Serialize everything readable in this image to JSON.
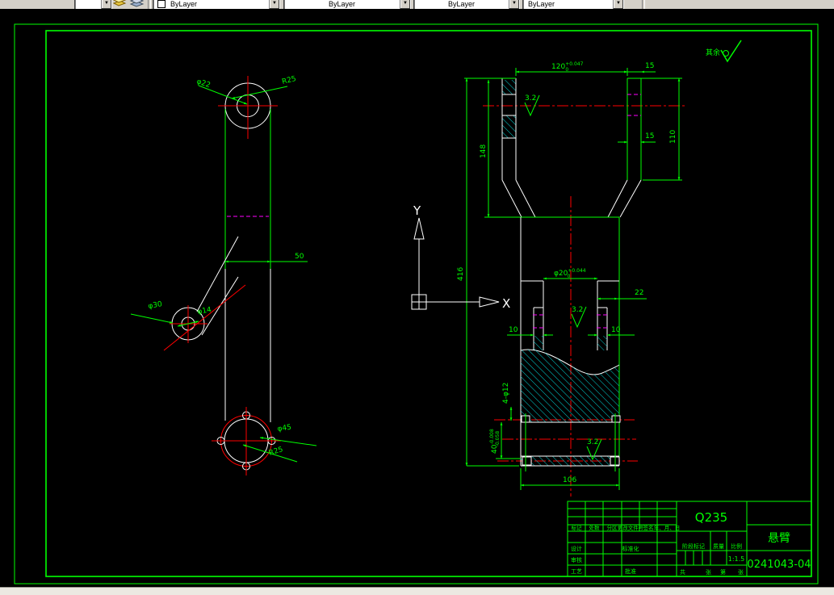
{
  "toolbar": {
    "combos": [
      "ByLayer",
      "ByLayer",
      "ByLayer",
      "ByLayer"
    ],
    "dropdown_glyph": "▼"
  },
  "colors": {
    "outline_green": "#00ff00",
    "centerline_red": "#ff0000",
    "hidden_magenta": "#ff00ff",
    "hatch_cyan": "#00cccc",
    "geometry_white": "#ffffff",
    "canvas_black": "#000000"
  },
  "ucs": {
    "x_label": "X",
    "y_label": "Y"
  },
  "notes": {
    "rest_note": "其余",
    "roughness": "3.2"
  },
  "left_view": {
    "dia22": "φ22",
    "r25_top": "R25",
    "d50": "50",
    "dia30": "φ30",
    "dia14": "φ14",
    "dia45": "φ45",
    "r25_bottom": "R25"
  },
  "right_view": {
    "d120": "120",
    "d120_tol_u": "+0.047",
    "d120_tol_l": "0",
    "d15_top": "15",
    "d110": "110",
    "d148": "148",
    "d15_mid": "15",
    "d416": "416",
    "dia20": "φ20",
    "dia20_tol_u": "+0.044",
    "dia20_tol_l": "0",
    "d22": "22",
    "d10_left": "10",
    "d10_right": "10",
    "d40": "40",
    "d40_tol_u": "-0.008",
    "d40_tol_l": "-0.058",
    "holes": "4-φ12",
    "d106": "106"
  },
  "title_block": {
    "material": "Q235",
    "part_name": "悬臂",
    "drawing_number": "0241043-04",
    "scale_value": "1:1.5",
    "labels": {
      "mark": "标记",
      "count": "处数",
      "zone": "分区",
      "change_file": "更改文件号",
      "signature": "签名",
      "date": "年、月、日",
      "design": "设计",
      "standardization": "标准化",
      "check": "审核",
      "process": "工艺",
      "approve": "批准",
      "stage_mark": "阶段标记",
      "mass": "质量",
      "scale": "比例",
      "sheet_total": "共",
      "sheet_unit1": "张",
      "sheet_no": "第",
      "sheet_unit2": "张"
    }
  }
}
